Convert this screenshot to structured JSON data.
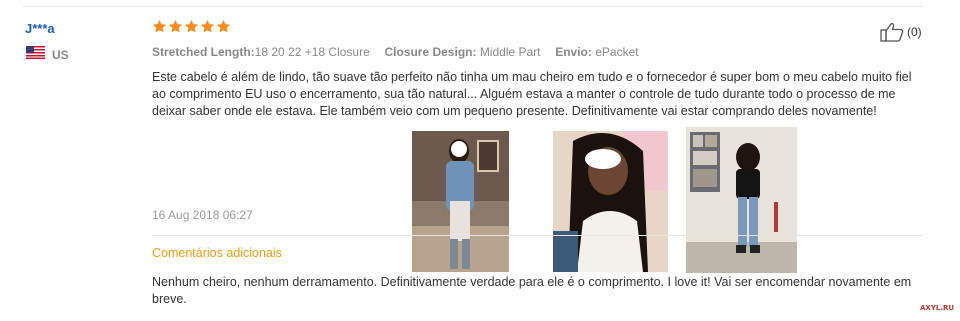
{
  "reviewer": {
    "name": "J***a",
    "country": "US",
    "flag_icon": "us-flag-icon"
  },
  "rating": {
    "stars": 5,
    "max": 5,
    "color": "#ff8c1a"
  },
  "attributes": [
    {
      "label": "Stretched Length:",
      "value": "18 20 22 +18 Closure"
    },
    {
      "label": "Closure Design:",
      "value": "Middle Part"
    },
    {
      "label": "Envio:",
      "value": "ePacket"
    }
  ],
  "helpful": {
    "icon": "thumbs-up-icon",
    "count": "(0)"
  },
  "review": {
    "text": "Este cabelo é além de lindo, tão suave tão perfeito não tinha um mau cheiro em tudo e o fornecedor é super bom o meu cabelo muito fiel ao comprimento EU uso o encerramento, sua tão natural... Alguém estava a manter o controle de tudo durante todo o processo de me deixar saber onde ele estava. Ele também veio com um pequeno presente. Definitivamente vai estar comprando deles novamente!",
    "date": "16 Aug 2018 06:27"
  },
  "additional": {
    "heading": "Comentários adicionais",
    "text": "Nenhum cheiro, nenhum derramamento. Definitivamente verdade para ele é o comprimento. I love it! Vai ser encomendar novamente em breve."
  },
  "watermark": "AXYL.RU",
  "colors": {
    "accent": "#f39c12",
    "link": "#1a5fb4",
    "muted": "#888888"
  }
}
